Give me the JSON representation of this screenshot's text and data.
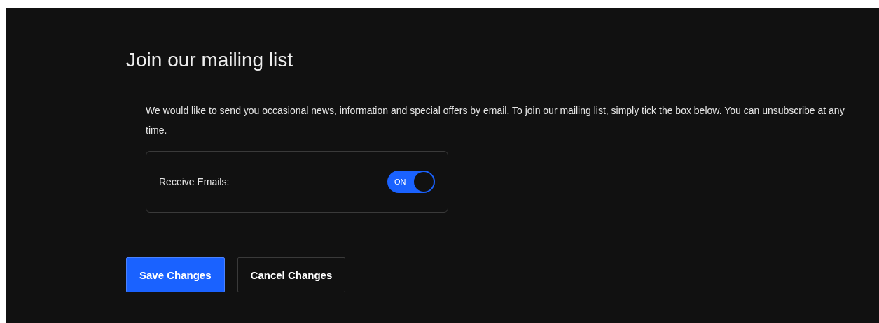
{
  "title": "Join our mailing list",
  "description": "We would like to send you occasional news, information and special offers by email. To join our mailing list, simply tick the box below. You can unsubscribe at any time.",
  "setting": {
    "label": "Receive Emails:",
    "on": true,
    "state_text": "ON"
  },
  "buttons": [
    {
      "label": "Save Changes",
      "kind": "primary"
    },
    {
      "label": "Cancel Changes",
      "kind": "secondary"
    }
  ]
}
